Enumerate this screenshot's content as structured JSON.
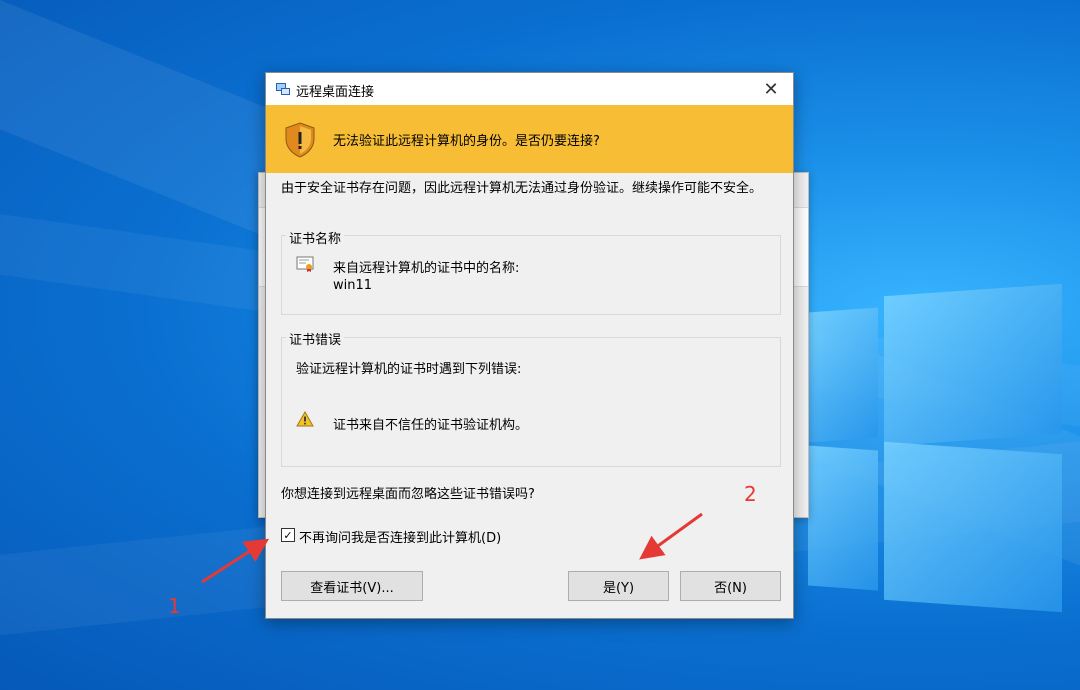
{
  "window": {
    "title": "远程桌面连接",
    "close_glyph": "✕"
  },
  "banner": {
    "text": "无法验证此远程计算机的身份。是否仍要连接?"
  },
  "description": "由于安全证书存在问题，因此远程计算机无法通过身份验证。继续操作可能不安全。",
  "cert_name_group": {
    "label": "证书名称",
    "item_label": "来自远程计算机的证书中的名称:",
    "item_value": "win11"
  },
  "cert_error_group": {
    "label": "证书错误",
    "intro": "验证远程计算机的证书时遇到下列错误:",
    "error": "证书来自不信任的证书验证机构。"
  },
  "question": "你想连接到远程桌面而忽略这些证书错误吗?",
  "dont_ask": {
    "label": "不再询问我是否连接到此计算机(D)",
    "checked": true,
    "check_glyph": "✓"
  },
  "buttons": {
    "view_cert": "查看证书(V)...",
    "yes": "是(Y)",
    "no": "否(N)"
  },
  "annotations": {
    "marker1": "1",
    "marker2": "2"
  },
  "colors": {
    "banner": "#f7be35",
    "annotation": "#e53935"
  }
}
